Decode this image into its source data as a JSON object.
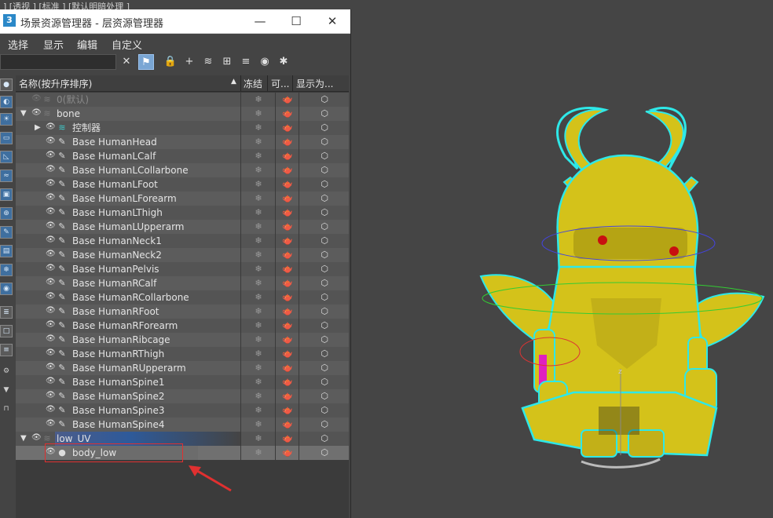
{
  "viewport": {
    "label": "] [透视 ] [标准 ] [默认明暗处理 ]",
    "character_desc": "yellow horned knight character model"
  },
  "window": {
    "app_icon": "3",
    "title": "场景资源管理器 - 层资源管理器",
    "minimize_icon": "—",
    "maximize_icon": "☐",
    "close_icon": "✕"
  },
  "menu": {
    "items": [
      "选择",
      "显示",
      "编辑",
      "自定义"
    ]
  },
  "toolbar": {
    "search_value": "",
    "clear_icon": "✕",
    "icons": [
      "filter-select-icon",
      "lock-icon",
      "add-layer-icon",
      "layers-icon",
      "hierarchy-icon",
      "stack-icon",
      "eye-layer-icon",
      "layer-add-icon"
    ]
  },
  "columns": {
    "name": "名称(按升序排序)",
    "sort_arrow": "▲",
    "freeze": "冻结",
    "render": "可...",
    "display": "显示为..."
  },
  "rows": [
    {
      "label": "0(默认)",
      "type": "layer",
      "dim": true
    },
    {
      "label": "bone",
      "type": "layer"
    },
    {
      "label": "控制器",
      "type": "group"
    },
    {
      "label": "Base HumanHead",
      "type": "bone"
    },
    {
      "label": "Base HumanLCalf",
      "type": "bone"
    },
    {
      "label": "Base HumanLCollarbone",
      "type": "bone"
    },
    {
      "label": "Base HumanLFoot",
      "type": "bone"
    },
    {
      "label": "Base HumanLForearm",
      "type": "bone"
    },
    {
      "label": "Base HumanLThigh",
      "type": "bone"
    },
    {
      "label": "Base HumanLUpperarm",
      "type": "bone"
    },
    {
      "label": "Base HumanNeck1",
      "type": "bone"
    },
    {
      "label": "Base HumanNeck2",
      "type": "bone"
    },
    {
      "label": "Base HumanPelvis",
      "type": "bone"
    },
    {
      "label": "Base HumanRCalf",
      "type": "bone"
    },
    {
      "label": "Base HumanRCollarbone",
      "type": "bone"
    },
    {
      "label": "Base HumanRFoot",
      "type": "bone"
    },
    {
      "label": "Base HumanRForearm",
      "type": "bone"
    },
    {
      "label": "Base HumanRibcage",
      "type": "bone"
    },
    {
      "label": "Base HumanRThigh",
      "type": "bone"
    },
    {
      "label": "Base HumanRUpperarm",
      "type": "bone"
    },
    {
      "label": "Base HumanSpine1",
      "type": "bone"
    },
    {
      "label": "Base HumanSpine2",
      "type": "bone"
    },
    {
      "label": "Base HumanSpine3",
      "type": "bone"
    },
    {
      "label": "Base HumanSpine4",
      "type": "bone"
    },
    {
      "label": "low_UV",
      "type": "layer"
    },
    {
      "label": "body_low",
      "type": "mesh"
    }
  ],
  "glyphs": {
    "eye": "👁",
    "freeze": "❄",
    "render": "🫖",
    "display": "⬡",
    "expand": "▼",
    "collapse": "▶",
    "bone": "✎"
  },
  "colors": {
    "model_yellow": "#d4c21a",
    "outline_cyan": "#2ee8e8",
    "highlight_red": "#e03030"
  }
}
